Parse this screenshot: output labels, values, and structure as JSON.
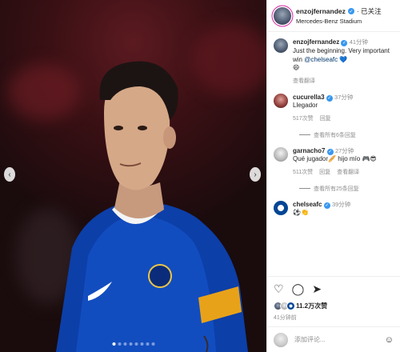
{
  "header": {
    "username": "enzojfernandez",
    "follow_state": "· 已关注",
    "location": "Mercedes-Benz Stadium"
  },
  "caption": {
    "username": "enzojfernandez",
    "time": "41分钟",
    "text": "Just the beginning. Very important win ",
    "mention": "@chelseafc",
    "emoji": "💙",
    "emoji2": "😄",
    "translate": "查看翻译"
  },
  "comments": [
    {
      "username": "cucurella3",
      "time": "37分钟",
      "text": "Llegador",
      "likes": "517次赞",
      "reply": "回复",
      "view_replies": "查看所有6条回复"
    },
    {
      "username": "garnacho7",
      "time": "27分钟",
      "text": "Qué jugador🥖 hijo mío 🎮😎",
      "likes": "511次赞",
      "reply": "回复",
      "translate": "查看翻译",
      "view_replies": "查看所有25条回复"
    },
    {
      "username": "chelseafc",
      "time": "39分钟",
      "text": "⚽👏"
    }
  ],
  "actions": {
    "like_icon": "heart-icon",
    "comment_icon": "comment-icon",
    "share_icon": "share-icon"
  },
  "likes": {
    "count": "11.2万次赞"
  },
  "time_ago": "41分钟前",
  "add_comment": {
    "placeholder": "添加评论..."
  },
  "media": {
    "slide_count": 8,
    "active_slide": 1
  }
}
